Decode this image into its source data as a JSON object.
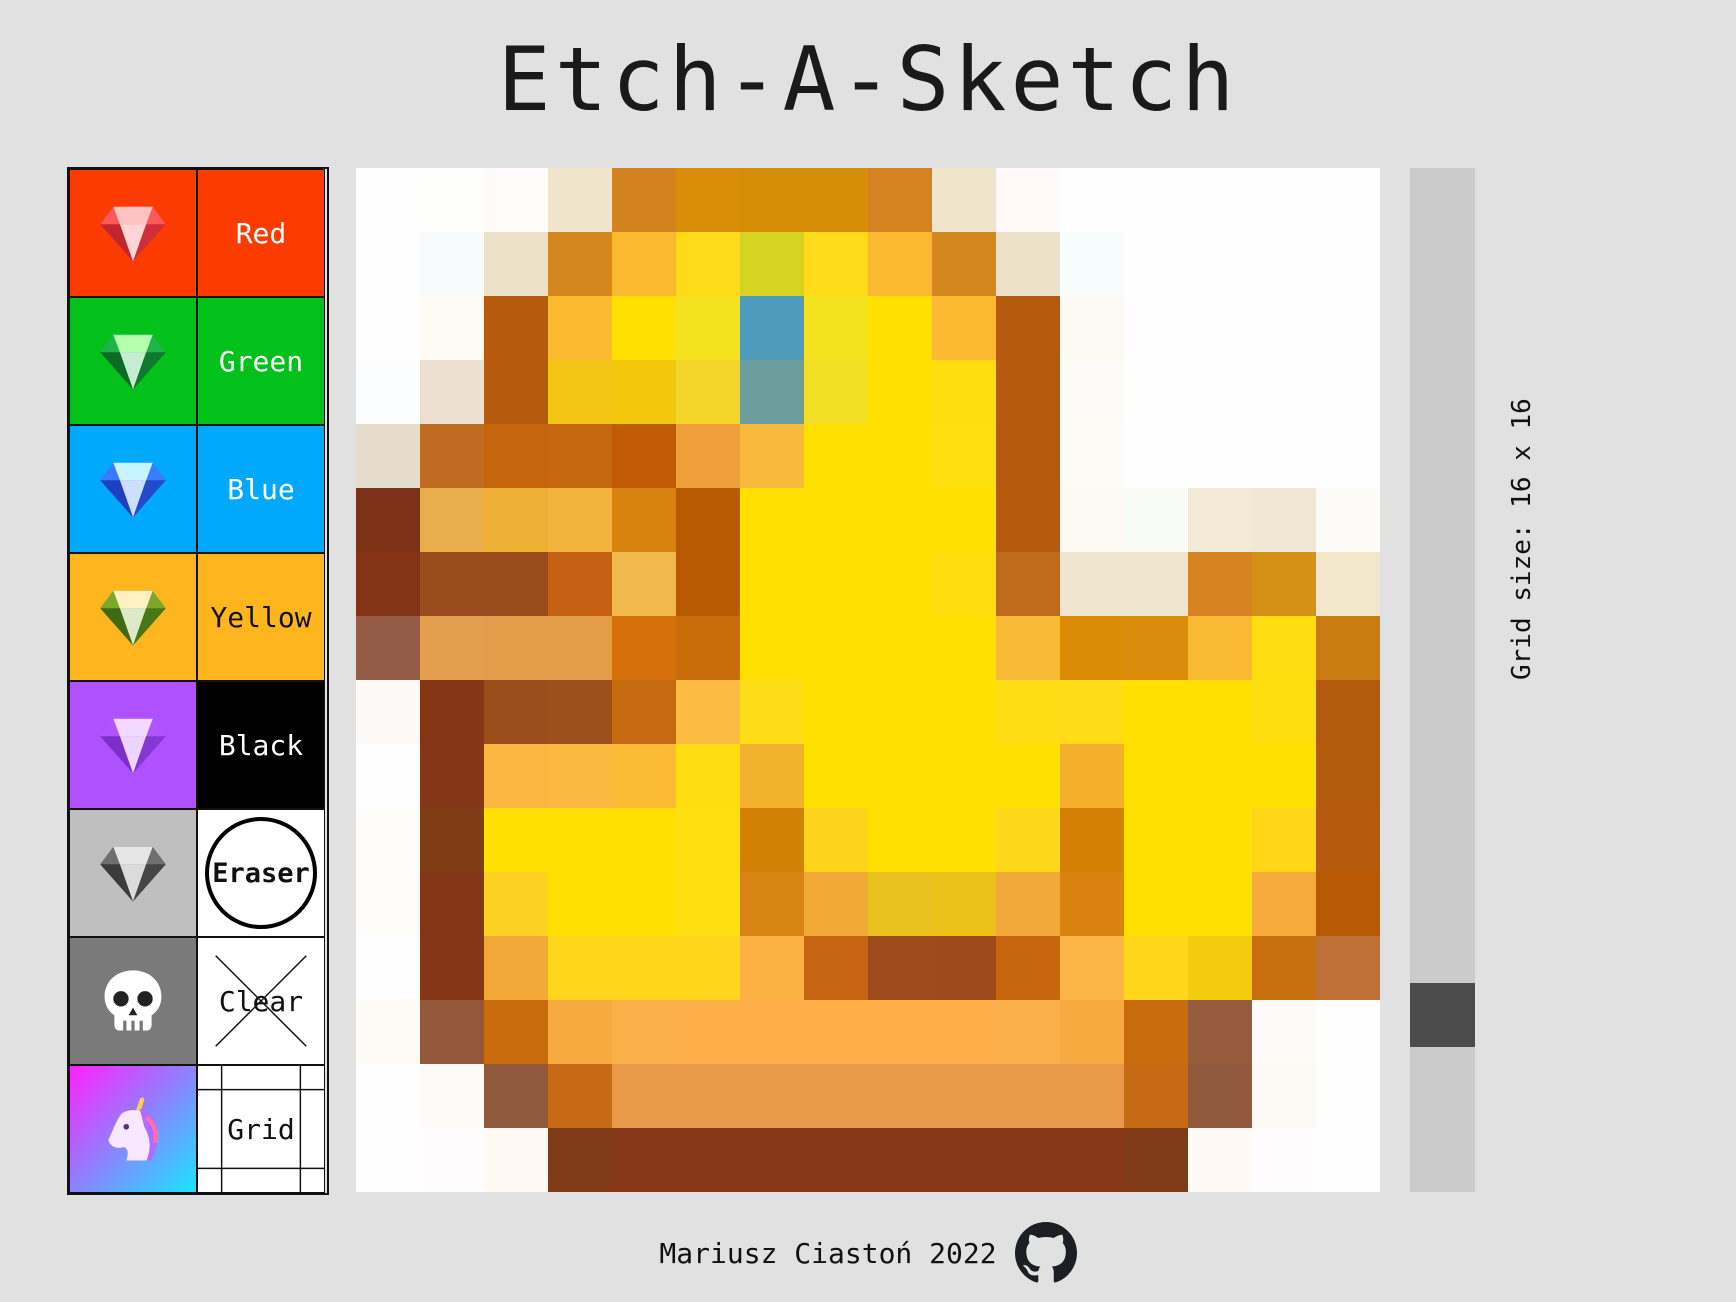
{
  "app": {
    "title": "Etch-A-Sketch"
  },
  "palette": {
    "colors": [
      {
        "label": "Red",
        "bg": "#fb3b00",
        "gem": [
          "#ff5a5a",
          "#ffc2c2",
          "#c0262f"
        ]
      },
      {
        "label": "Green",
        "bg": "#02c11a",
        "gem": [
          "#1fb34a",
          "#b4ffb0",
          "#0b6b24"
        ]
      },
      {
        "label": "Blue",
        "bg": "#00a9fb",
        "gem": [
          "#3a7bff",
          "#c6f4ff",
          "#1f3fbf"
        ]
      },
      {
        "label": "Yellow",
        "bg": "#feb51e",
        "gem": [
          "#7aa82a",
          "#fff1c2",
          "#3f6a12"
        ],
        "dark": true
      },
      {
        "label": "Black",
        "bg": "#000000",
        "tile": "#af51ff",
        "gem": [
          "#b155ff",
          "#f3d9ff",
          "#7a30c8"
        ]
      }
    ],
    "eraser_label": "Eraser",
    "eraser_tile": "#bfbfbf",
    "clear_label": "Clear",
    "clear_tile": "#7a7a7a",
    "grid_label": "Grid",
    "rainbow_from": "#ff20ff",
    "rainbow_to": "#18e6ff"
  },
  "board": {
    "size": 16,
    "pixels": [
      [
        "#fefefe",
        "#fefefd",
        "#fffbfb",
        "#f0e5cb",
        "#d2821f",
        "#d98d08",
        "#d58d07",
        "#d68d08",
        "#d58320",
        "#f0e5cb",
        "#fff9fa",
        "#fefefe",
        "#fefefe",
        "#fefefe",
        "#fefefe",
        "#fefefe"
      ],
      [
        "#fefefe",
        "#f7fbfc",
        "#ede0c8",
        "#d5871f",
        "#fbb930",
        "#fedb18",
        "#d6d322",
        "#fedb18",
        "#fbb930",
        "#d5871f",
        "#ede0c8",
        "#f7fcfd",
        "#fefefe",
        "#fefefe",
        "#fefefe",
        "#fefefe"
      ],
      [
        "#fefefe",
        "#fdfbf3",
        "#b65a0e",
        "#fbb930",
        "#ffe000",
        "#f3e21d",
        "#4e9bbc",
        "#f3e21d",
        "#ffe000",
        "#fbb930",
        "#b65a0e",
        "#fdfaf4",
        "#fefefe",
        "#fefefe",
        "#fefefe",
        "#fefefe"
      ],
      [
        "#fbfcfd",
        "#eee0d1",
        "#b65a0e",
        "#f3c616",
        "#f3c70d",
        "#f4d52a",
        "#6c9e9e",
        "#f3df23",
        "#ffe000",
        "#fedd0e",
        "#b65a0e",
        "#fdfbf7",
        "#fefefe",
        "#fefefe",
        "#fefefe",
        "#fefefe"
      ],
      [
        "#e5dccc",
        "#bf6b21",
        "#c6650e",
        "#c66810",
        "#c05a04",
        "#efa03a",
        "#f8b93d",
        "#ffe000",
        "#ffe000",
        "#fedf0f",
        "#b65a0e",
        "#fefbf7",
        "#fefefe",
        "#fefefe",
        "#fefefe",
        "#fefefe"
      ],
      [
        "#7d3116",
        "#e9ae4b",
        "#edb035",
        "#f2b43c",
        "#d7830e",
        "#b85a01",
        "#ffe000",
        "#ffe000",
        "#ffe000",
        "#ffe000",
        "#b65a0e",
        "#fdfaf4",
        "#f9fbf6",
        "#f2e9d6",
        "#f2e7d5",
        "#fdfbf7"
      ],
      [
        "#843316",
        "#9a4c1c",
        "#994b1b",
        "#c66013",
        "#f1b84c",
        "#b85a01",
        "#ffe000",
        "#ffe000",
        "#ffe000",
        "#fedc0e",
        "#bf6b1c",
        "#f0e5cf",
        "#f0e5cf",
        "#d78322",
        "#d49115",
        "#f2e7cb"
      ],
      [
        "#945b46",
        "#e39e4e",
        "#e39c4a",
        "#e39c4a",
        "#d6700a",
        "#c96c0a",
        "#ffe000",
        "#ffe000",
        "#ffe000",
        "#ffe000",
        "#f9bb36",
        "#dc8b07",
        "#da8c0d",
        "#f9b932",
        "#fedd10",
        "#c97c10"
      ],
      [
        "#fcf9f7",
        "#843617",
        "#9c4d1c",
        "#9e501c",
        "#c66a11",
        "#fbbb40",
        "#fddd18",
        "#ffe000",
        "#ffe000",
        "#ffe000",
        "#fedd15",
        "#fddb17",
        "#ffe000",
        "#ffe000",
        "#fedd0e",
        "#b45a0d"
      ],
      [
        "#fefefe",
        "#843617",
        "#fbb641",
        "#fbb940",
        "#fbbb34",
        "#fedd10",
        "#f3b22c",
        "#ffe000",
        "#ffe000",
        "#ffe000",
        "#ffe000",
        "#f5b02b",
        "#ffe000",
        "#ffe000",
        "#ffe000",
        "#b45a0d"
      ],
      [
        "#fefdf9",
        "#803c15",
        "#ffe000",
        "#ffe000",
        "#ffe000",
        "#fedf0f",
        "#d18205",
        "#fdd41c",
        "#ffe000",
        "#ffe000",
        "#fdd81a",
        "#d38005",
        "#ffe000",
        "#ffe000",
        "#fed617",
        "#b65a0e"
      ],
      [
        "#fefdf9",
        "#843617",
        "#fdd121",
        "#ffe000",
        "#ffe000",
        "#fedf0f",
        "#d88513",
        "#f1a835",
        "#e9c11e",
        "#eac219",
        "#f1a93a",
        "#d9820f",
        "#ffe000",
        "#ffe000",
        "#f5aa3a",
        "#b85a04"
      ],
      [
        "#fefefe",
        "#843617",
        "#f2a837",
        "#fed71c",
        "#fed71c",
        "#fed71c",
        "#fbb240",
        "#c86514",
        "#9e4c1c",
        "#9e4a1b",
        "#c8660f",
        "#fbb446",
        "#fed71c",
        "#f3cc0f",
        "#c86f10",
        "#bf7135"
      ],
      [
        "#fefbf7",
        "#93573a",
        "#c86c0d",
        "#f6aa40",
        "#fbb149",
        "#ffaf48",
        "#ffaf48",
        "#ffaf48",
        "#ffaf48",
        "#ffaf48",
        "#fbb149",
        "#f6aa40",
        "#c86c0d",
        "#955b3c",
        "#fdfbf7",
        "#fefefe"
      ],
      [
        "#fefefe",
        "#fdfbf7",
        "#905a3f",
        "#c66b13",
        "#e89a4a",
        "#e89a4a",
        "#e89a4a",
        "#e89a4a",
        "#e89a4a",
        "#e89a4a",
        "#e89a4a",
        "#e89a4a",
        "#c66b13",
        "#915a3f",
        "#fbfaf4",
        "#fefefe"
      ],
      [
        "#fefefe",
        "#fffcfd",
        "#fef9f3",
        "#7f3a17",
        "#853718",
        "#853718",
        "#853718",
        "#853718",
        "#853718",
        "#853718",
        "#853718",
        "#853718",
        "#7f3a17",
        "#fef9f3",
        "#fffcfd",
        "#fefefe"
      ]
    ]
  },
  "slider": {
    "value": 16,
    "min": 1,
    "max": 100
  },
  "grid_size": {
    "text": "Grid size: 16 x 16"
  },
  "footer": {
    "credit": "Mariusz Ciastoń 2022"
  }
}
